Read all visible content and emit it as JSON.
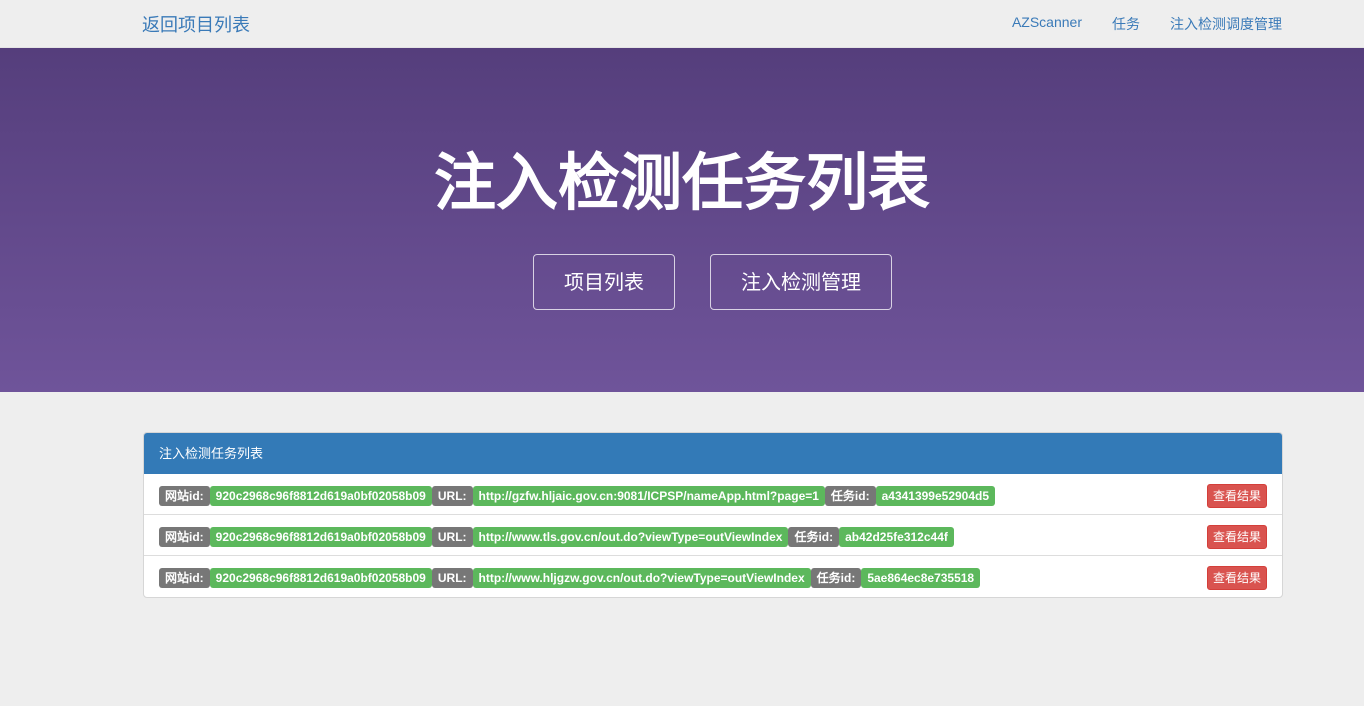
{
  "navbar": {
    "brand": "返回项目列表",
    "links": [
      "AZScanner",
      "任务",
      "注入检测调度管理"
    ]
  },
  "hero": {
    "title": "注入检测任务列表",
    "buttons": [
      "项目列表",
      "注入检测管理"
    ]
  },
  "panel": {
    "title": "注入检测任务列表",
    "label_site_id": "网站id:",
    "label_url": "URL:",
    "label_task_id": "任务id:",
    "result_button": "查看结果",
    "rows": [
      {
        "site_id": "920c2968c96f8812d619a0bf02058b09",
        "url": "http://gzfw.hljaic.gov.cn:9081/ICPSP/nameApp.html?page=1",
        "task_id": "a4341399e52904d5"
      },
      {
        "site_id": "920c2968c96f8812d619a0bf02058b09",
        "url": "http://www.tls.gov.cn/out.do?viewType=outViewIndex",
        "task_id": "ab42d25fe312c44f"
      },
      {
        "site_id": "920c2968c96f8812d619a0bf02058b09",
        "url": "http://www.hljgzw.gov.cn/out.do?viewType=outViewIndex",
        "task_id": "5ae864ec8e735518"
      }
    ]
  },
  "colors": {
    "hero_top": "#553e7c",
    "hero_bottom": "#6f549a",
    "panel_heading": "#337ab7",
    "label_gray": "#777777",
    "label_green": "#5cb85c",
    "danger": "#d9534f",
    "link": "#3a7ab8"
  }
}
